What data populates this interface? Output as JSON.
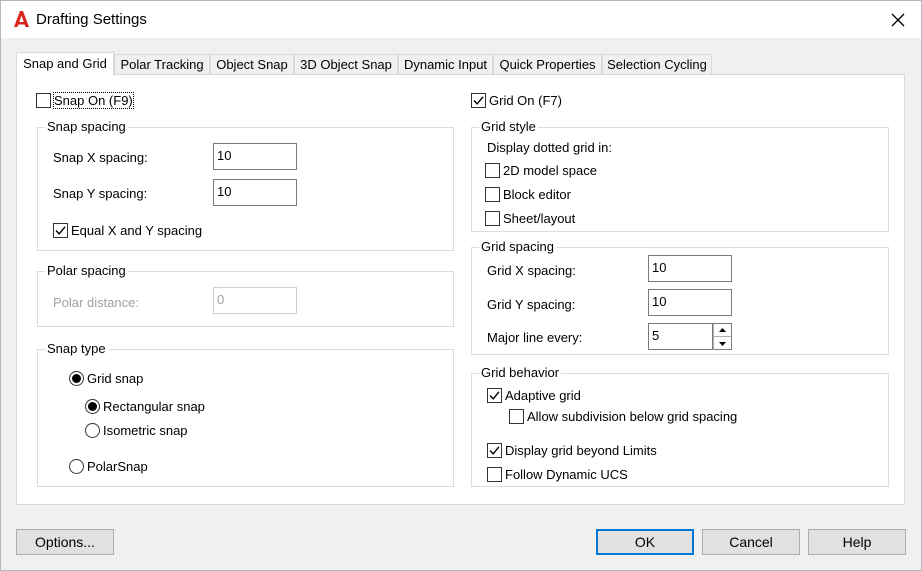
{
  "window": {
    "title": "Drafting Settings",
    "close_glyph": "✕"
  },
  "tabs": [
    {
      "label": "Snap and Grid",
      "active": true
    },
    {
      "label": "Polar Tracking"
    },
    {
      "label": "Object Snap"
    },
    {
      "label": "3D Object Snap"
    },
    {
      "label": "Dynamic Input"
    },
    {
      "label": "Quick Properties"
    },
    {
      "label": "Selection Cycling"
    }
  ],
  "snap": {
    "snap_on_label": "Snap On (F9)",
    "snap_on_checked": false,
    "snap_spacing_title": "Snap spacing",
    "snap_x_label": "Snap X spacing:",
    "snap_x_value": "10",
    "snap_y_label": "Snap Y spacing:",
    "snap_y_value": "10",
    "equal_xy_label": "Equal X and Y spacing",
    "equal_xy_checked": true,
    "polar_spacing_title": "Polar spacing",
    "polar_distance_label": "Polar distance:",
    "polar_distance_value": "0",
    "snap_type_title": "Snap type",
    "grid_snap_label": "Grid snap",
    "rectangular_snap_label": "Rectangular snap",
    "isometric_snap_label": "Isometric snap",
    "polarsnap_label": "PolarSnap"
  },
  "grid": {
    "grid_on_label": "Grid On (F7)",
    "grid_on_checked": true,
    "grid_style_title": "Grid style",
    "display_dotted_label": "Display dotted grid in:",
    "model_space_label": "2D model space",
    "block_editor_label": "Block editor",
    "sheet_layout_label": "Sheet/layout",
    "grid_spacing_title": "Grid spacing",
    "grid_x_label": "Grid X spacing:",
    "grid_x_value": "10",
    "grid_y_label": "Grid Y spacing:",
    "grid_y_value": "10",
    "major_line_label": "Major line every:",
    "major_line_value": "5",
    "grid_behavior_title": "Grid behavior",
    "adaptive_grid_label": "Adaptive grid",
    "allow_subdivision_label": "Allow subdivision below grid spacing",
    "display_beyond_label": "Display grid beyond Limits",
    "follow_ucs_label": "Follow Dynamic UCS"
  },
  "buttons": {
    "options": "Options...",
    "ok": "OK",
    "cancel": "Cancel",
    "help": "Help"
  },
  "colors": {
    "accent": "#0078d7",
    "app_icon": "#d7241d"
  }
}
